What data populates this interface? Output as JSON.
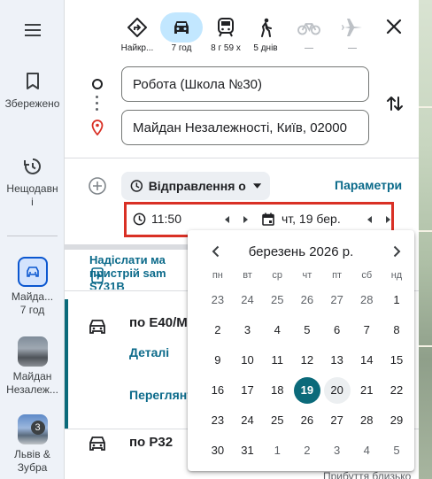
{
  "sidebar": {
    "menu_label": "",
    "saved_label": "Збережено",
    "recent_label": "Нещодавні",
    "recents": [
      {
        "label": "Майда...\n7 год"
      },
      {
        "label": "Майдан Незалеж..."
      },
      {
        "label": "Львів & Зубра",
        "badge": "3"
      }
    ]
  },
  "modes": [
    {
      "label": "Найкр...",
      "icon": "best-route-icon"
    },
    {
      "label": "7 год",
      "icon": "car-icon",
      "selected": true
    },
    {
      "label": "8 г 59 х",
      "icon": "train-icon"
    },
    {
      "label": "5 днів",
      "icon": "walk-icon"
    },
    {
      "label": "—",
      "icon": "bike-icon",
      "disabled": true
    },
    {
      "label": "—",
      "icon": "plane-icon",
      "disabled": true
    }
  ],
  "origin": {
    "value": "Робота (Школа №30)"
  },
  "destination": {
    "value": "Майдан Незалежності, Київ, 02000"
  },
  "depart": {
    "label": "Відправлення о"
  },
  "params_label": "Параметри",
  "time": {
    "value": "11:50"
  },
  "date": {
    "value": "чт, 19 бер."
  },
  "promo": {
    "line1": "Надіслати ма",
    "line2": "пристрій sam",
    "line3": "S731B"
  },
  "routes": [
    {
      "name": "по E40/M",
      "details": "Деталі",
      "preview": "Переглянути"
    },
    {
      "name": "по P32"
    }
  ],
  "footer_text": "Прибуття близько",
  "calendar": {
    "title": "березень 2026 р.",
    "weekdays": [
      "пн",
      "вт",
      "ср",
      "чт",
      "пт",
      "сб",
      "нд"
    ],
    "weeks": [
      [
        "23",
        "24",
        "25",
        "26",
        "27",
        "28",
        "1"
      ],
      [
        "2",
        "3",
        "4",
        "5",
        "6",
        "7",
        "8"
      ],
      [
        "9",
        "10",
        "11",
        "12",
        "13",
        "14",
        "15"
      ],
      [
        "16",
        "17",
        "18",
        "19",
        "20",
        "21",
        "22"
      ],
      [
        "23",
        "24",
        "25",
        "26",
        "27",
        "28",
        "29"
      ],
      [
        "30",
        "31",
        "1",
        "2",
        "3",
        "4",
        "5"
      ]
    ],
    "selected_day": "19",
    "hovered_day": "20"
  },
  "colors": {
    "accent": "#0b6a7a",
    "highlight_box": "#d93025",
    "selected_mode": "#c2e7ff"
  }
}
